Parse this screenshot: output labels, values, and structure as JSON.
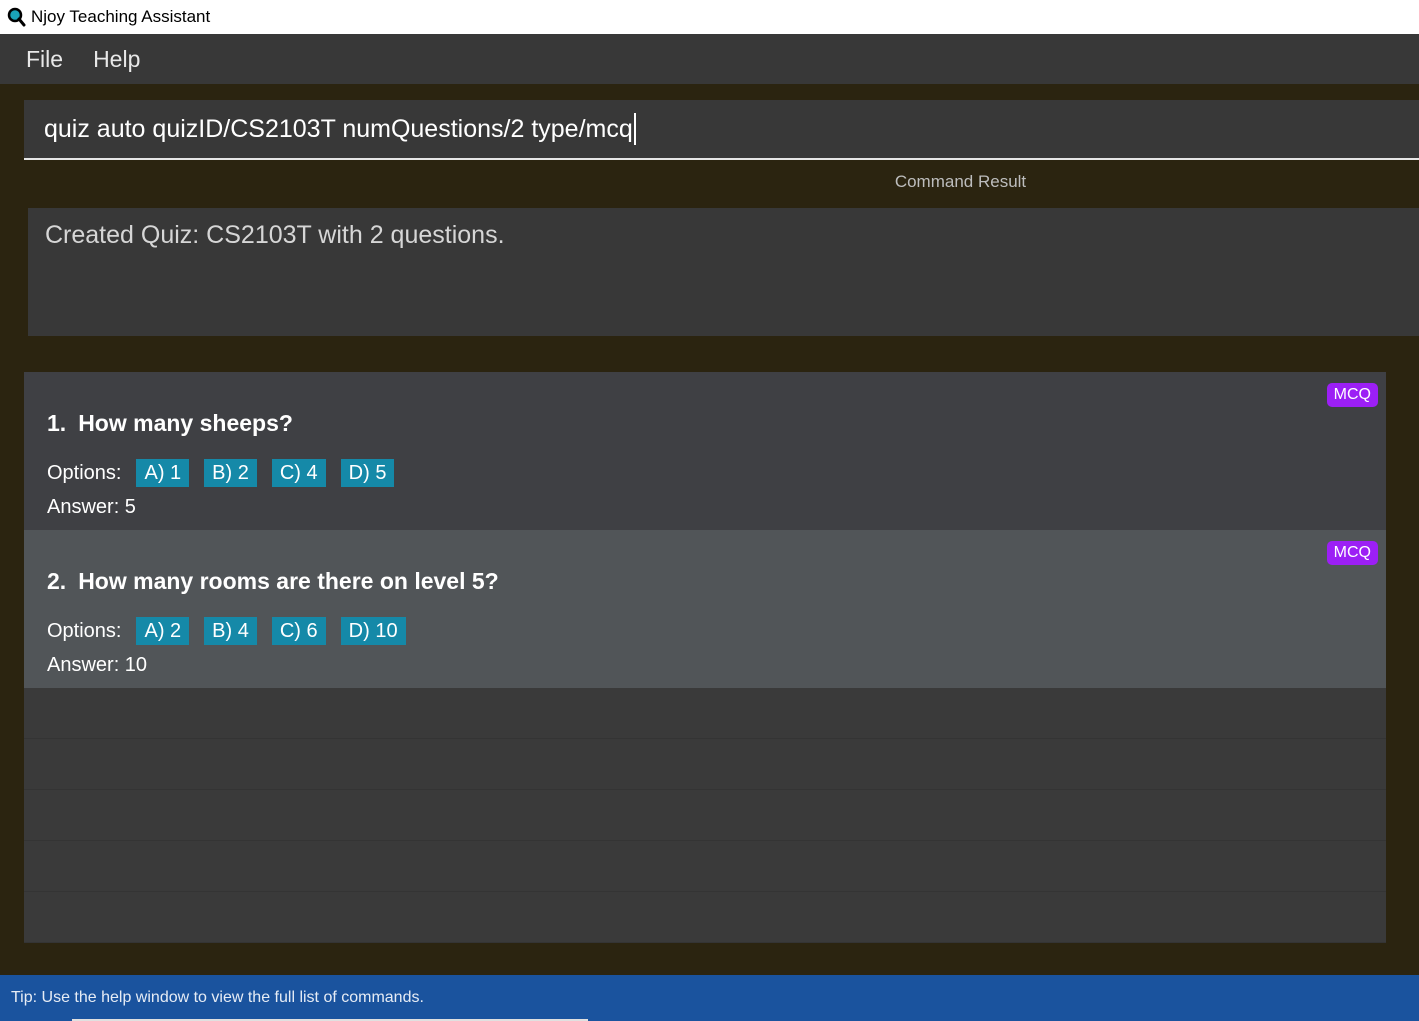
{
  "window": {
    "title": "Njoy Teaching Assistant",
    "icon": "magnifier-icon"
  },
  "menu": {
    "items": [
      "File",
      "Help"
    ]
  },
  "command": {
    "value": "quiz auto quizID/CS2103T numQuestions/2 type/mcq"
  },
  "result": {
    "header": "Command Result",
    "text": "Created Quiz: CS2103T with 2 questions."
  },
  "questions": [
    {
      "number": "1.",
      "text": "How many sheeps?",
      "type": "MCQ",
      "options_label": "Options:",
      "options": [
        "A) 1",
        "B) 2",
        "C) 4",
        "D) 5"
      ],
      "answer": "Answer: 5"
    },
    {
      "number": "2.",
      "text": "How many rooms are there on level 5?",
      "type": "MCQ",
      "options_label": "Options:",
      "options": [
        "A) 2",
        "B) 4",
        "C) 6",
        "D) 10"
      ],
      "answer": "Answer: 10"
    }
  ],
  "status": {
    "tip": "Tip: Use the help window to view the full list of commands."
  },
  "colors": {
    "background": "#2b2410",
    "panel": "#383838",
    "type_badge": "#9c1ff5",
    "option_chip": "#1589a8",
    "status_bar": "#1a539e"
  }
}
